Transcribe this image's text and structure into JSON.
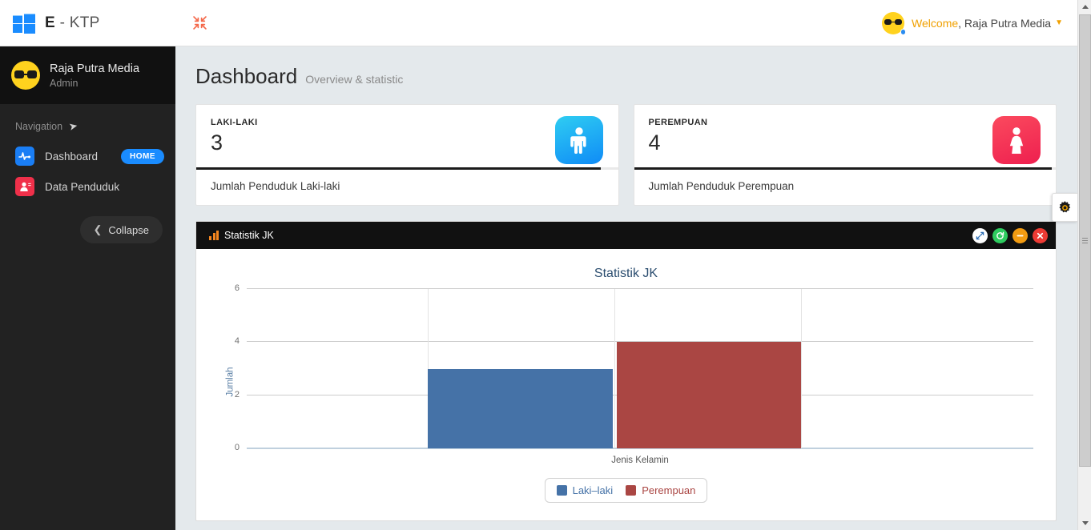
{
  "topbar": {
    "brand_bold": "E",
    "brand_rest": " - KTP",
    "logo_icon": "windows-logo-icon",
    "toggle_icon": "collapse-arrows-icon",
    "welcome_prefix": "Welcome",
    "welcome_user": ", Raja Putra Media",
    "caret_icon": "caret-down-icon"
  },
  "sidebar": {
    "profile_name": "Raja Putra Media",
    "profile_role": "Admin",
    "nav_title": "Navigation",
    "nav_title_icon": "paper-plane-icon",
    "items": [
      {
        "label": "Dashboard",
        "icon": "activity-pulse-icon",
        "badge": "HOME"
      },
      {
        "label": "Data Penduduk",
        "icon": "user-card-icon",
        "badge": ""
      }
    ],
    "collapse_label": "Collapse",
    "collapse_icon": "chevron-left-icon"
  },
  "page": {
    "title": "Dashboard",
    "subtitle": "Overview & statistic"
  },
  "cards": [
    {
      "label": "LAKI-LAKI",
      "value": "3",
      "footer": "Jumlah Penduduk Laki-laki",
      "icon": "male-figure-icon",
      "progress_pct": 96,
      "accent": "#0f8bf6"
    },
    {
      "label": "PEREMPUAN",
      "value": "4",
      "footer": "Jumlah Penduduk Perempuan",
      "icon": "female-figure-icon",
      "progress_pct": 99,
      "accent": "#ee1f4f"
    }
  ],
  "settings_tab": {
    "icon": "gear-icon"
  },
  "panel": {
    "title": "Statistik JK",
    "title_icon": "bar-chart-icon",
    "tools": [
      {
        "name": "expand",
        "icon": "expand-arrows-icon",
        "color": "#ffffff"
      },
      {
        "name": "refresh",
        "icon": "refresh-icon",
        "color": "#2ecc5f"
      },
      {
        "name": "collapse",
        "icon": "minus-icon",
        "color": "#f39c12"
      },
      {
        "name": "close",
        "icon": "times-icon",
        "color": "#ee3b34"
      }
    ]
  },
  "chart_data": {
    "type": "bar",
    "title": "Statistik JK",
    "xlabel": "Jenis Kelamin",
    "ylabel": "Jumlah",
    "categories": [
      "Jenis Kelamin"
    ],
    "yticks": [
      0,
      2,
      4,
      6
    ],
    "ylim": [
      0,
      6
    ],
    "grid": true,
    "legend_position": "bottom",
    "series": [
      {
        "name": "Laki–laki",
        "values": [
          3
        ],
        "color": "#4572a7"
      },
      {
        "name": "Perempuan",
        "values": [
          4
        ],
        "color": "#aa4643"
      }
    ]
  },
  "scrollbar": {
    "up_icon": "triangle-up-icon",
    "down_icon": "triangle-down-icon",
    "thumb": "scrollbar-thumb"
  }
}
